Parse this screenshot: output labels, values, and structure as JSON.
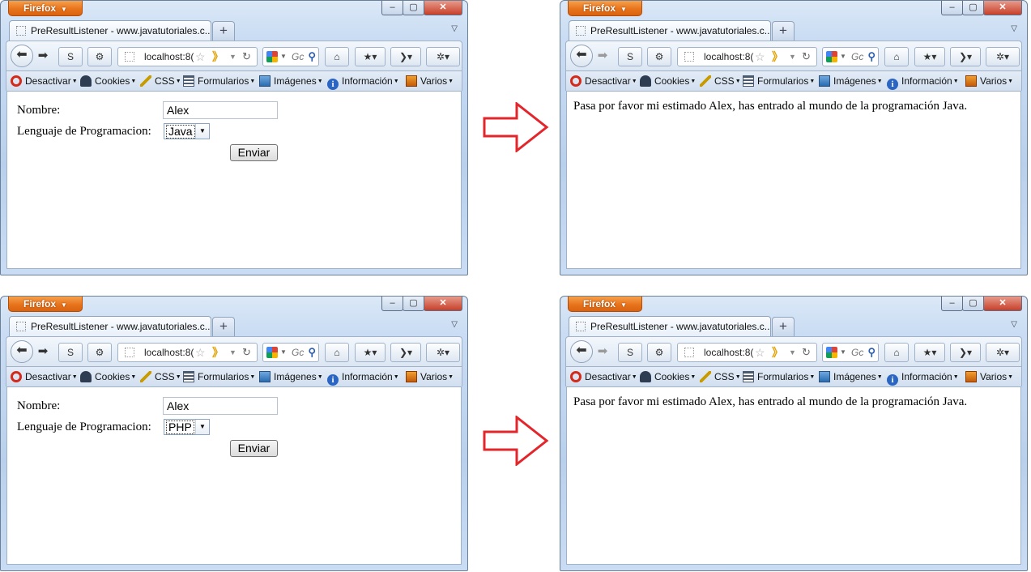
{
  "browser": {
    "app_button": "Firefox",
    "tab_title": "PreResultListener - www.javatutoriales.c...",
    "new_tab": "+",
    "url": "localhost:8(",
    "search_placeholder": "Gc",
    "window_controls": {
      "minimize": "–",
      "maximize": "▢",
      "close": "✕"
    },
    "bookmarks": [
      {
        "label": "Desactivar",
        "icon": "forbid-icon"
      },
      {
        "label": "Cookies",
        "icon": "user-icon"
      },
      {
        "label": "CSS",
        "icon": "wand-icon"
      },
      {
        "label": "Formularios",
        "icon": "form-icon"
      },
      {
        "label": "Imágenes",
        "icon": "image-icon"
      },
      {
        "label": "Información",
        "icon": "info-icon"
      },
      {
        "label": "Varios",
        "icon": "misc-icon"
      }
    ]
  },
  "form": {
    "name_label": "Nombre:",
    "lang_label": "Lenguaje de Programacion:",
    "submit_label": "Enviar"
  },
  "panels": [
    {
      "name_value": "Alex",
      "lang_value": "Java"
    },
    {
      "name_value": "Alex",
      "lang_value": "PHP"
    }
  ],
  "result": {
    "message": "Pasa por favor mi estimado Alex, has entrado al mundo de la programación Java."
  },
  "colors": {
    "arrow": "#e3262b",
    "firefox_button": "#e8741d"
  }
}
